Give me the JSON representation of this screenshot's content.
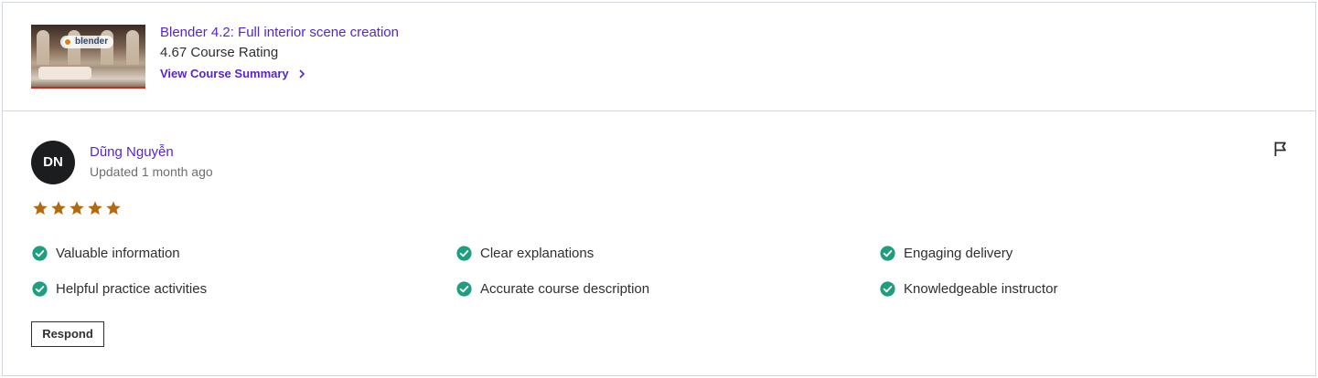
{
  "course": {
    "thumbnail_logo": "blender",
    "title": "Blender 4.2: Full interior scene creation",
    "rating": "4.67 Course Rating",
    "summary_link": "View Course Summary",
    "summary_icon": "chevron-right-icon"
  },
  "review": {
    "avatar_initials": "DN",
    "reviewer_name": "Dũng Nguyễn",
    "updated": "Updated 1 month ago",
    "flag_icon": "flag-icon",
    "rating_stars": 5,
    "star_color": "#b4690e",
    "check_color": "#1e9e7e",
    "tags": [
      "Valuable information",
      "Clear explanations",
      "Engaging delivery",
      "Helpful practice activities",
      "Accurate course description",
      "Knowledgeable instructor"
    ],
    "respond_label": "Respond"
  },
  "colors": {
    "link": "#5624d0",
    "text": "#2d2f31",
    "muted": "#6a6f73",
    "border": "#d1d7dc"
  }
}
